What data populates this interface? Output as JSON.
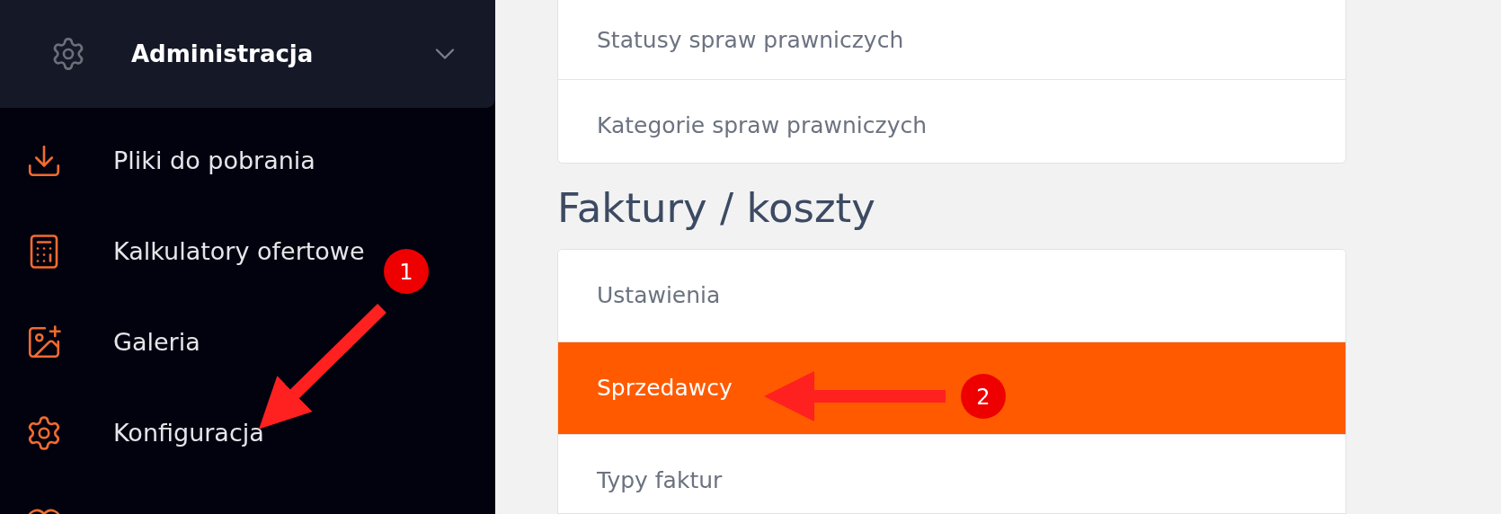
{
  "sidebar": {
    "header": {
      "title": "Administracja",
      "expanded": true
    },
    "items": [
      {
        "label": "Pliki do pobrania"
      },
      {
        "label": "Kalkulatory ofertowe"
      },
      {
        "label": "Galeria"
      },
      {
        "label": "Konfiguracja"
      }
    ]
  },
  "main": {
    "top_card": {
      "items": [
        {
          "label": "Statusy spraw prawniczych"
        },
        {
          "label": "Kategorie spraw prawniczych"
        }
      ]
    },
    "section": {
      "heading": "Faktury / koszty",
      "items": [
        {
          "label": "Ustawienia",
          "selected": false
        },
        {
          "label": "Sprzedawcy",
          "selected": true
        },
        {
          "label": "Typy faktur",
          "selected": false
        }
      ]
    }
  },
  "annotations": [
    {
      "label": "1"
    },
    {
      "label": "2"
    }
  ]
}
